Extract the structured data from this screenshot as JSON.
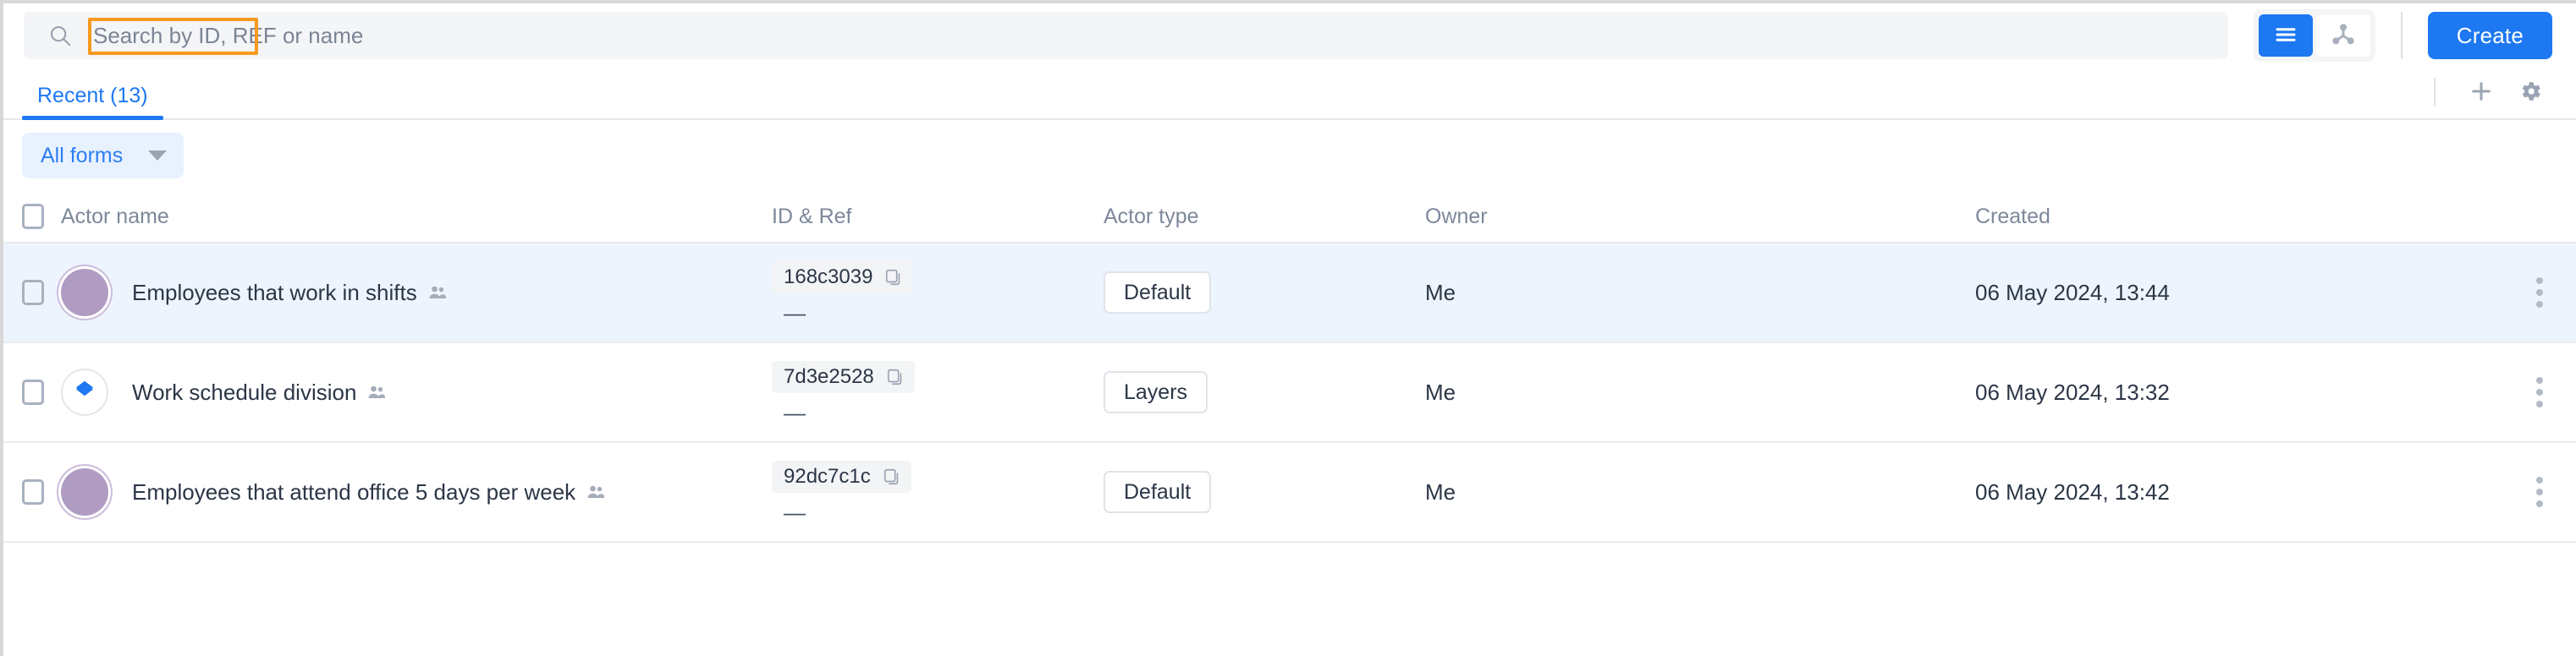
{
  "search": {
    "placeholder": "Search by ID, REF or name",
    "value": "",
    "icon": "search-icon",
    "highlight_color": "#f59a1e"
  },
  "toolbar": {
    "view_toggle": {
      "list_view_icon": "list-view-icon",
      "graph_view_icon": "graph-view-icon",
      "active": "list"
    },
    "create_label": "Create",
    "accent_color": "#1d78f2"
  },
  "tabs": {
    "items": [
      {
        "label": "Recent (13)",
        "active": true
      }
    ],
    "actions": {
      "add_icon": "plus-icon",
      "settings_icon": "gear-icon"
    }
  },
  "filter": {
    "label": "All forms",
    "caret_icon": "chevron-down-icon"
  },
  "table": {
    "columns": [
      "Actor name",
      "ID & Ref",
      "Actor type",
      "Owner",
      "Created"
    ],
    "rows": [
      {
        "name": "Employees that work in shifts",
        "name_badge_icon": "people-icon",
        "avatar": "purple",
        "id": "168c3039",
        "ref": "—",
        "copy_icon": "copy-icon",
        "type": "Default",
        "owner": "Me",
        "created": "06 May 2024, 13:44",
        "highlighted": true,
        "menu_icon": "kebab-menu-icon"
      },
      {
        "name": "Work schedule division",
        "name_badge_icon": "people-icon",
        "avatar": "layers",
        "id": "7d3e2528",
        "ref": "—",
        "copy_icon": "copy-icon",
        "type": "Layers",
        "owner": "Me",
        "created": "06 May 2024, 13:32",
        "highlighted": false,
        "menu_icon": "kebab-menu-icon"
      },
      {
        "name": "Employees that attend office 5 days per week",
        "name_badge_icon": "people-icon",
        "avatar": "purple",
        "id": "92dc7c1c",
        "ref": "—",
        "copy_icon": "copy-icon",
        "type": "Default",
        "owner": "Me",
        "created": "06 May 2024, 13:42",
        "highlighted": false,
        "menu_icon": "kebab-menu-icon"
      }
    ]
  }
}
